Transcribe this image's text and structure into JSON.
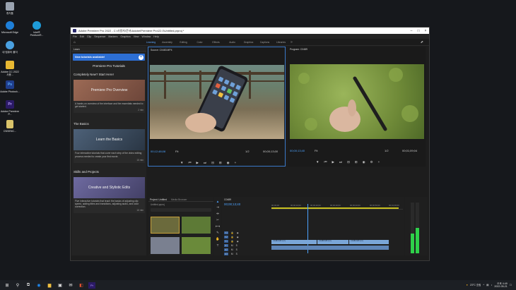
{
  "desktop": {
    "icons": [
      {
        "label": "휴지통",
        "color": "#9aa3b0"
      },
      {
        "label": "Microsoft Edge",
        "color": "#1e7fd8"
      },
      {
        "label": "Intel® Pentium®...",
        "color": "#1e9bd8"
      },
      {
        "label": "내 컴퓨터 폴더",
        "color": "#4aa0e0"
      },
      {
        "label": "Adobe CC 2022 사용...",
        "color": "#e8b832"
      },
      {
        "label": "Adobe Photosh...",
        "color": "#1f3d8c"
      },
      {
        "label": "Adobe Premiere P...",
        "color": "#2b1a66"
      },
      {
        "label": "CNSENC...",
        "color": "#d9c36a"
      }
    ]
  },
  "app": {
    "title": "Adobe Premiere Pro 2022 - C:\\사용자\\문서\\Adobe\\Premiere Pro\\22.0\\Untitled.prproj *",
    "menu": [
      "File",
      "Edit",
      "Clip",
      "Sequence",
      "Markers",
      "Graphics",
      "View",
      "Window",
      "Help"
    ],
    "workspaces": [
      "Learning",
      "Assembly",
      "Editing",
      "Color",
      "Effects",
      "Audio",
      "Graphics",
      "Captions",
      "Libraries"
    ],
    "active_workspace": "Learning",
    "more_icon": "chevron-right-icon"
  },
  "learn": {
    "tab": "Learn",
    "new_tutorials": "New tutorials available!",
    "heading": "Premiere Pro Tutorials",
    "sections": [
      {
        "title": "Completely New? Start Here!",
        "card": {
          "title": "Premiere Pro Overview",
          "desc": "A hands-on overview of the interface and the essentials needed to get started.",
          "duration": "2 min",
          "bg": "#8a5a4a"
        }
      },
      {
        "title": "The Basics",
        "card": {
          "title": "Learn the Basics",
          "desc": "Four interactive tutorials that cover each step of the video editing process needed to create your first movie.",
          "duration": "15 min",
          "bg": "#3a4b5e"
        }
      },
      {
        "title": "Skills and Projects",
        "card": {
          "title": "Creative and Stylistic Edits",
          "desc": "Five interactive tutorials that teach the basics of adjusting clip speed, adding titles and transitions, adjusting audio, and color correction.",
          "duration": "16 min",
          "bg": "#5d5a8a"
        }
      }
    ]
  },
  "source": {
    "tab": "Source: C0483.MP4",
    "timecode": "00;12;48;08",
    "fit": "Fit",
    "quality": "1/2",
    "duration": "00;00;13;00"
  },
  "program": {
    "tab": "Program: C0489",
    "timecode": "00;00;13;40",
    "fit": "Fit",
    "quality": "1/2",
    "duration": "00;01;09;04"
  },
  "project": {
    "tabs": [
      "Project: Untitled",
      "Media Browser"
    ],
    "bin": "Untitled.prproj"
  },
  "timeline": {
    "sequence": "C0489",
    "timecode": "00;00;13;40",
    "ruler": [
      "00;00;00",
      "00;00;10;00",
      "00;00;20;00",
      "00;00;30;00",
      "00;00;40;00",
      "00;00;50;00",
      "00;01;00;00"
    ],
    "tracks": [
      "V3",
      "V2",
      "V1",
      "A1",
      "A2",
      "A3"
    ],
    "clips": [
      "C0483.MP4 [V]",
      "C0488.MP4 [V]",
      "C0489.MP4 [V]"
    ]
  },
  "taskbar": {
    "weather": "23°C 흐림",
    "time": "오후 4:49",
    "date": "2022-05-21"
  }
}
